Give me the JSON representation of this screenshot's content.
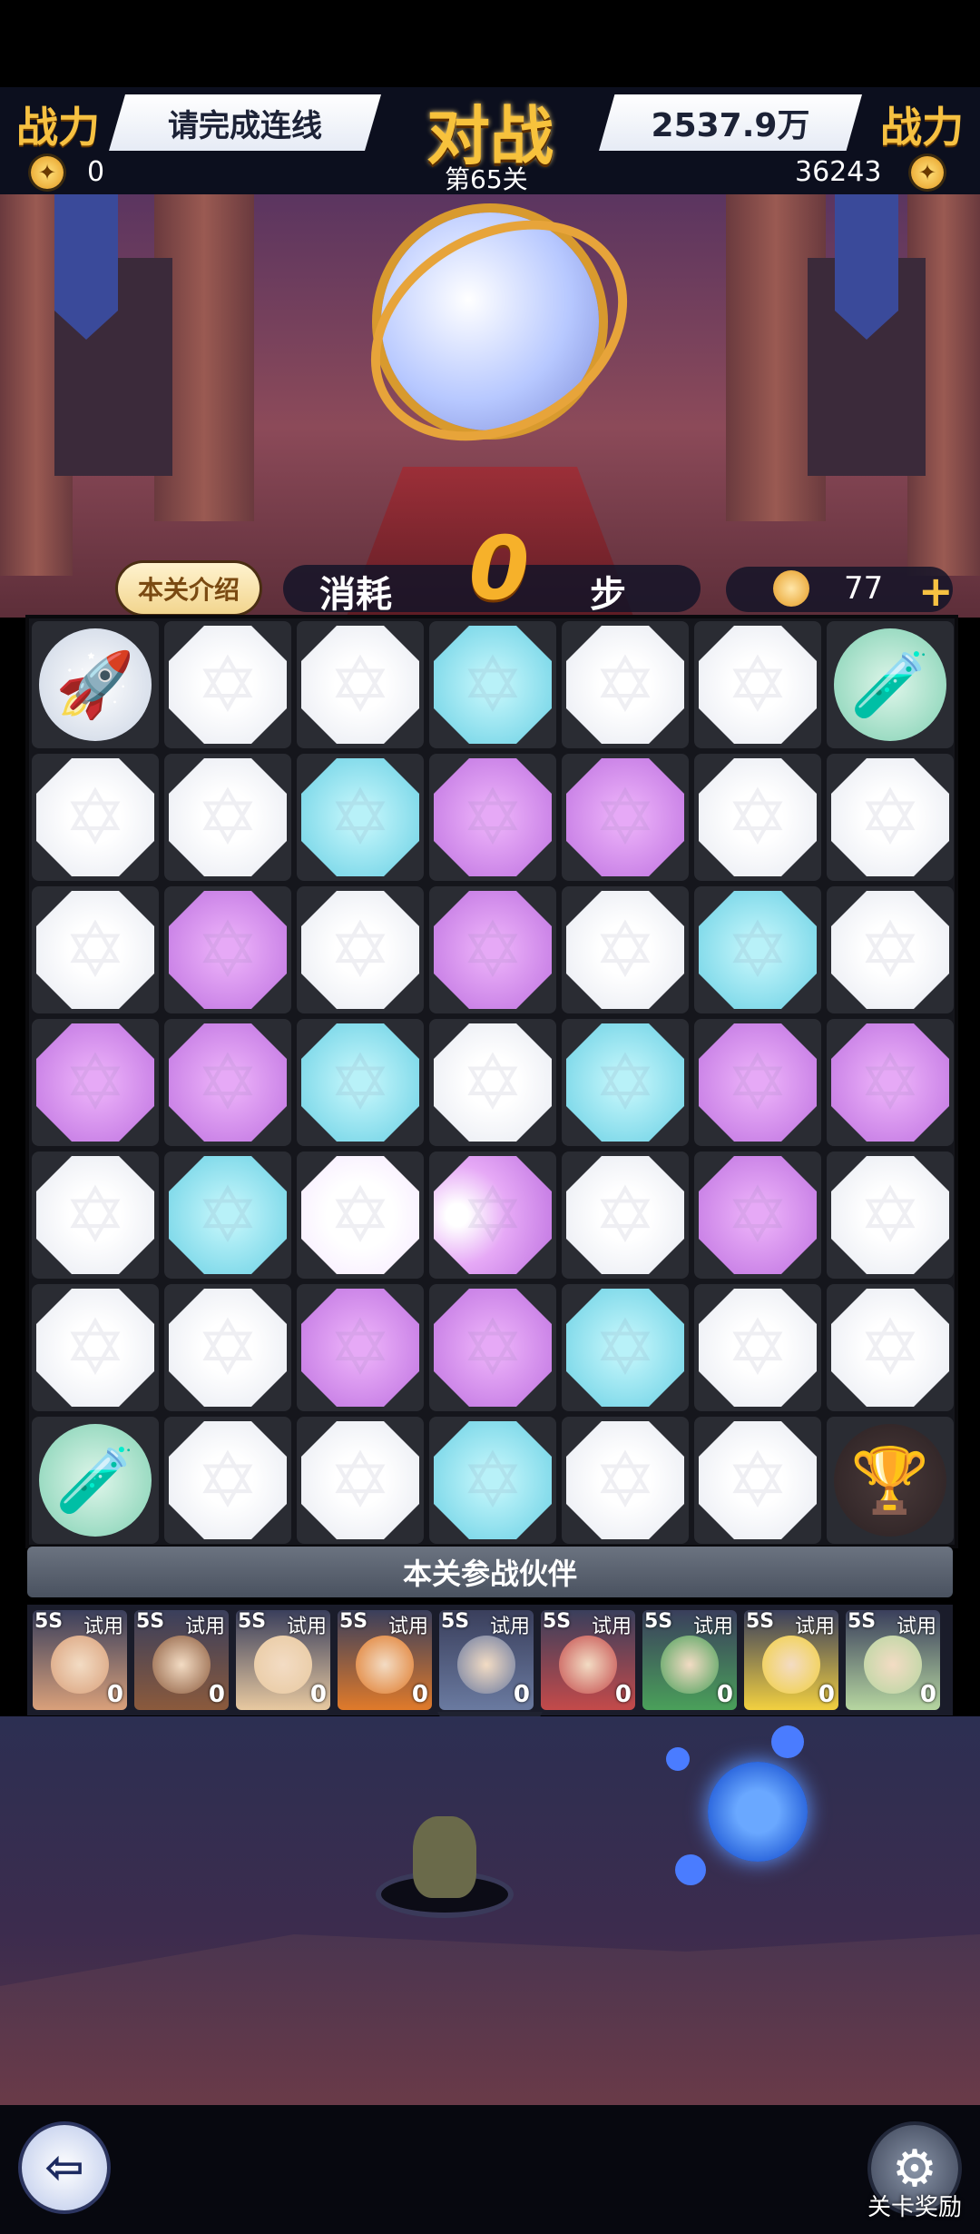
{
  "header": {
    "left_label": "战力",
    "left_banner": "请完成连线",
    "center": "对战",
    "right_banner": "2537.9万",
    "right_label": "战力",
    "left_score": "0",
    "level": "第65关",
    "right_score": "36243"
  },
  "info_bar": {
    "intro_button": "本关介绍",
    "steps_label": "消耗",
    "steps_value": "0",
    "steps_unit": "步",
    "coins": "77",
    "add_symbol": "+"
  },
  "board": {
    "rows": [
      [
        "rocket",
        "white",
        "white",
        "blue",
        "white",
        "white",
        "potion"
      ],
      [
        "white",
        "white",
        "blue",
        "purple",
        "purple",
        "white",
        "white"
      ],
      [
        "white",
        "purple",
        "white",
        "purple",
        "white",
        "blue",
        "white"
      ],
      [
        "purple",
        "purple",
        "blue",
        "white",
        "blue",
        "purple",
        "purple"
      ],
      [
        "white",
        "blue",
        "glow",
        "glow-purple",
        "white",
        "purple",
        "white"
      ],
      [
        "white",
        "white",
        "purple",
        "purple",
        "blue",
        "white",
        "white"
      ],
      [
        "potion",
        "white",
        "white",
        "blue",
        "white",
        "white",
        "trophy"
      ]
    ],
    "colors": {
      "white": "#ffffff",
      "blue": "#7fd8e8",
      "purple": "#c985ea"
    }
  },
  "partners": {
    "title": "本关参战伙伴",
    "items": [
      {
        "rank": "5S",
        "tag": "试用",
        "count": "0",
        "color": "#d9a07a"
      },
      {
        "rank": "5S",
        "tag": "试用",
        "count": "0",
        "color": "#8b5a3c"
      },
      {
        "rank": "5S",
        "tag": "试用",
        "count": "0",
        "color": "#e8c9a0"
      },
      {
        "rank": "5S",
        "tag": "试用",
        "count": "0",
        "color": "#e07a2a"
      },
      {
        "rank": "5S",
        "tag": "试用",
        "count": "0",
        "color": "#6a7aa0"
      },
      {
        "rank": "5S",
        "tag": "试用",
        "count": "0",
        "color": "#c44a4a"
      },
      {
        "rank": "5S",
        "tag": "试用",
        "count": "0",
        "color": "#4aa05a"
      },
      {
        "rank": "5S",
        "tag": "试用",
        "count": "0",
        "color": "#f2d040"
      },
      {
        "rank": "5S",
        "tag": "试用",
        "count": "0",
        "color": "#b6d6a0"
      }
    ],
    "collapse_icon": "︾"
  },
  "footer": {
    "back_icon": "⇦",
    "reward_icon": "⚙",
    "reward_label": "关卡奖励"
  }
}
